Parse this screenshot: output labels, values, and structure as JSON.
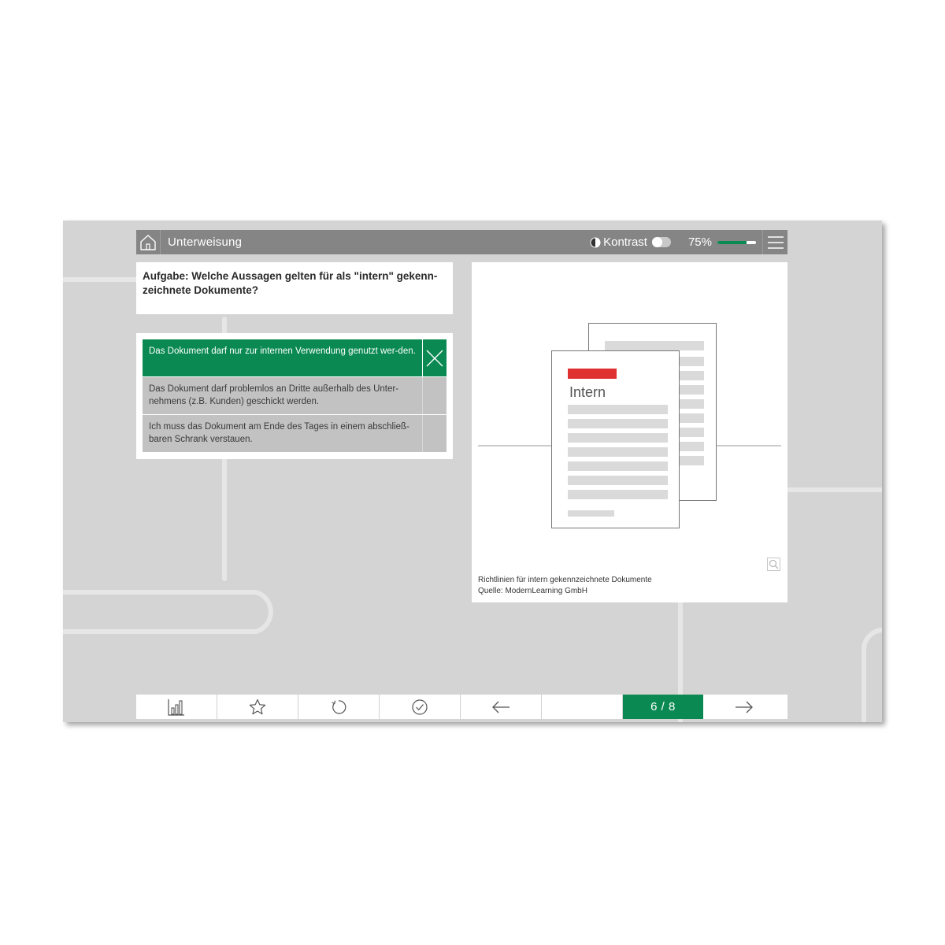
{
  "header": {
    "title": "Unterweisung",
    "contrast_label": "Kontrast",
    "contrast_on": false,
    "progress_label": "75%",
    "progress_value": 0.75
  },
  "question": {
    "text": "Aufgabe: Welche Aussagen gelten für als \"intern\" gekenn-zeichnete Dokumente?"
  },
  "answers": [
    {
      "text": "Das Dokument darf nur zur internen Verwendung genutzt wer-den.",
      "selected": true
    },
    {
      "text": "Das Dokument darf problemlos an Dritte außerhalb des Unter-nehmens (z.B. Kunden) geschickt werden.",
      "selected": false
    },
    {
      "text": "Ich muss das Dokument am Ende des Tages in einem abschließ-baren Schrank verstauen.",
      "selected": false
    }
  ],
  "media": {
    "document_label": "Intern",
    "caption_line1": "Richtlinien für intern gekennzeichnete Dokumente",
    "caption_line2": "Quelle: ModernLearning GmbH"
  },
  "footer": {
    "page_indicator": "6 / 8"
  },
  "colors": {
    "accent": "#0a8a52",
    "header_bg": "#858585",
    "background": "#d4d4d4",
    "stamp_red": "#e03131"
  }
}
